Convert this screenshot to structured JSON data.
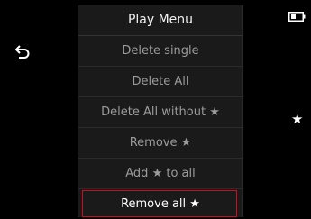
{
  "menu": {
    "title": "Play Menu",
    "items": [
      {
        "label": "Delete single"
      },
      {
        "label": "Delete All"
      },
      {
        "label": "Delete All without ★"
      },
      {
        "label": "Remove ★"
      },
      {
        "label": "Add ★ to all"
      },
      {
        "label": "Remove all ★"
      }
    ],
    "selected_index": 5
  },
  "icons": {
    "back": "back-arrow-icon",
    "battery": "battery-icon",
    "star": "star-icon"
  },
  "colors": {
    "background": "#000000",
    "menu_bg": "#1a1a1a",
    "item_text": "#9b9b9b",
    "selected_text": "#ffffff",
    "selection_frame": "#d10a1f"
  }
}
